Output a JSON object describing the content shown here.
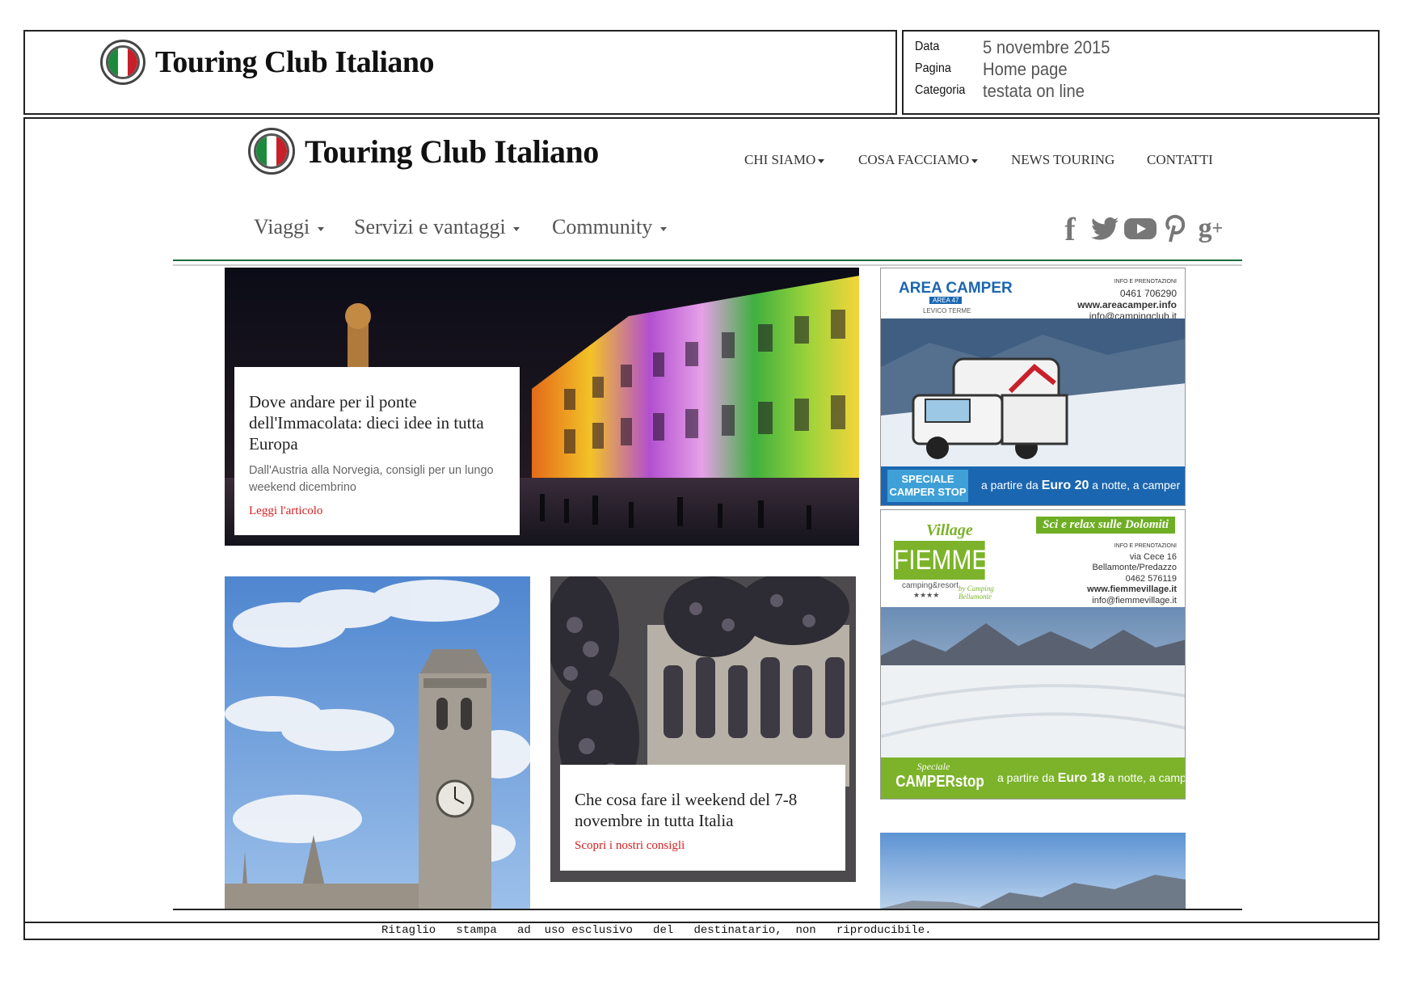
{
  "header": {
    "logo_text": "Touring Club Italiano",
    "meta": [
      {
        "key": "Data",
        "value": "5 novembre 2015"
      },
      {
        "key": "Pagina",
        "value": "Home page"
      },
      {
        "key": "Categoria",
        "value": "testata on line"
      }
    ]
  },
  "site": {
    "logo_text": "Touring Club Italiano",
    "top_nav": [
      "CHI SIAMO",
      "COSA FACCIAMO",
      "NEWS TOURING",
      "CONTATTI"
    ],
    "main_nav": [
      "Viaggi",
      "Servizi e vantaggi",
      "Community"
    ],
    "social": [
      "facebook-icon",
      "twitter-icon",
      "youtube-icon",
      "pinterest-icon",
      "google-plus-icon"
    ]
  },
  "articles": {
    "featured": {
      "title": "Dove andare per il ponte dell'Immacolata: dieci idee in tutta Europa",
      "subtitle": "Dall'Austria alla Norvegia, consigli per un lungo weekend dicembrino",
      "link": "Leggi l'articolo"
    },
    "weekend": {
      "title": "Che cosa fare il weekend del 7-8 novembre in tutta Italia",
      "link": "Scopri i nostri consigli"
    }
  },
  "ads": {
    "area_camper": {
      "brand": "AREA CAMPER",
      "brand_sub": "AREA 47",
      "place": "LEVICO TERME",
      "info_label": "INFO E PRENOTAZIONI",
      "phone": "0461 706290",
      "web": "www.areacamper.info",
      "email": "info@campingclub.it",
      "badge": "SPECIALE CAMPER STOP",
      "offer_prefix": "a partire da",
      "offer_price": "Euro 20",
      "offer_suffix": "a notte, a camper"
    },
    "fiemme": {
      "village": "Village",
      "brand": "FIEMME",
      "brand_sub": "camping&resort",
      "stars": "★★★★",
      "by": "by Camping Bellamonte",
      "headline": "Sci e relax sulle Dolomiti",
      "info_label": "INFO E PRENOTAZIONI",
      "address": "via Cece 16",
      "town": "Bellamonte/Predazzo",
      "phone": "0462 576119",
      "web": "www.fiemmevillage.it",
      "email": "info@fiemmevillage.it",
      "badge_top": "Speciale",
      "badge": "CAMPERstop",
      "offer_prefix": "a partire da",
      "offer_price": "Euro 18",
      "offer_suffix": "a notte, a camper"
    }
  },
  "footer": {
    "text": "Ritaglio   stampa   ad  uso esclusivo   del   destinatario,  non   riproducibile."
  }
}
